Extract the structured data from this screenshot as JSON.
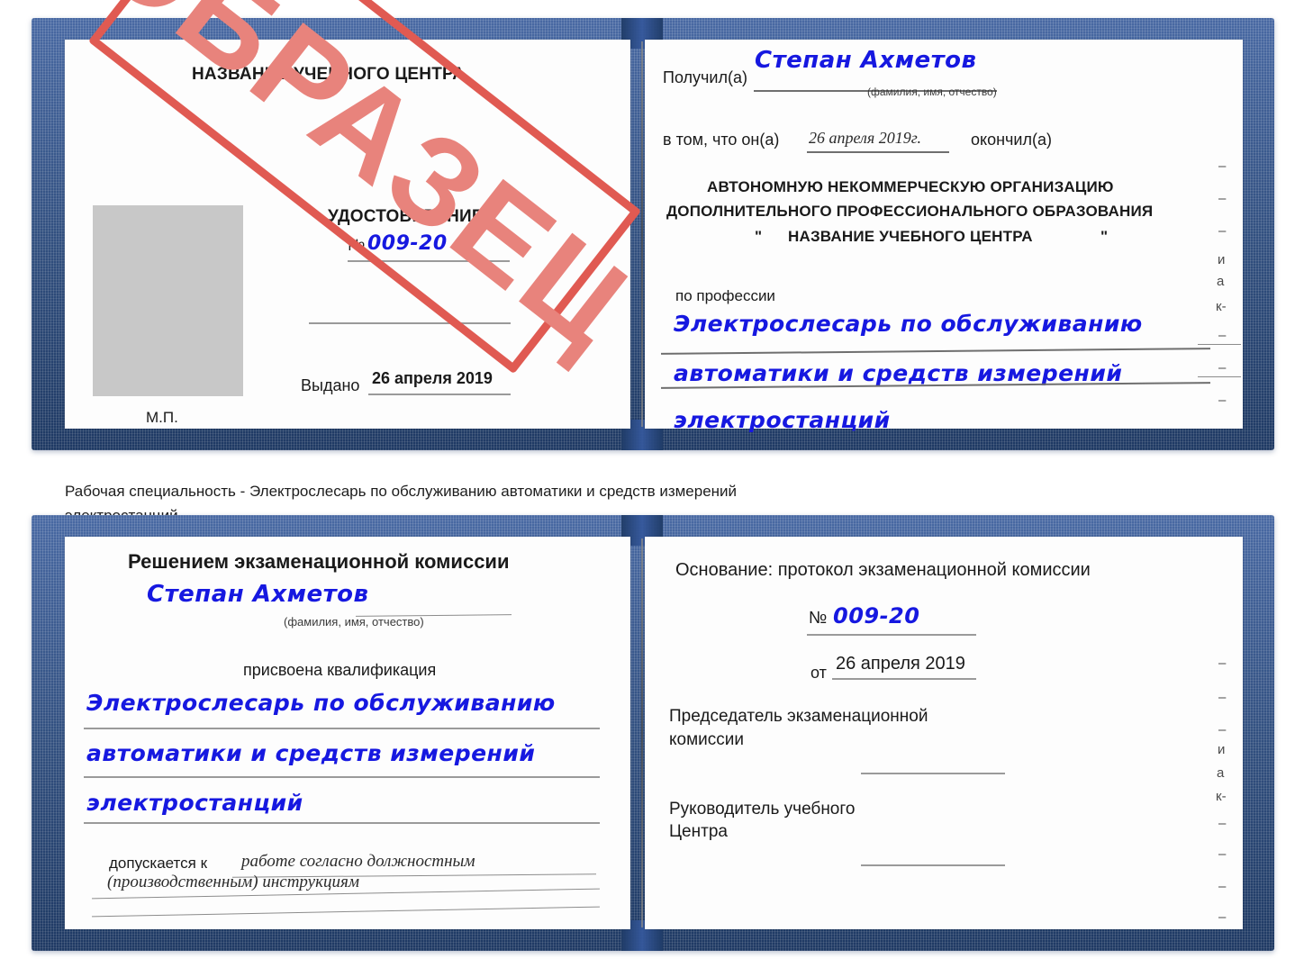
{
  "document": {
    "kind": "Удостоверение (свидетельство) о профессиональном обучении",
    "watermark": "ОБРАЗЕЦ"
  },
  "caption": {
    "line1": "Рабочая специальность - Электрослесарь по обслуживанию автоматики и средств измерений",
    "line2": "электростанций"
  },
  "cert_top": {
    "left_page": {
      "center_title": "НАЗВАНИЕ УЧЕБНОГО ЦЕНТРА",
      "doc_title": "УДОСТОВЕРЕНИЕ",
      "number_label": "№",
      "number_value": "009-20",
      "issued_label": "Выдано",
      "issued_value": "26 апреля 2019",
      "seal_label": "М.П.",
      "photo_placeholder": "photo-area"
    },
    "right_page": {
      "received_label": "Получил(а)",
      "received_value": "Степан Ахметов",
      "received_hint": "(фамилия, имя, отчество)",
      "in_that_label": "в том, что он(а)",
      "completion_date": "26 апреля 2019г.",
      "finished_label": "окончил(а)",
      "org_line1": "АВТОНОМНУЮ НЕКОММЕРЧЕСКУЮ ОРГАНИЗАЦИЮ",
      "org_line2": "ДОПОЛНИТЕЛЬНОГО ПРОФЕССИОНАЛЬНОГО ОБРАЗОВАНИЯ",
      "org_quote_open": "\"",
      "org_name": "НАЗВАНИЕ УЧЕБНОГО ЦЕНТРА",
      "org_quote_close": "\"",
      "profession_label": "по профессии",
      "profession_line1": "Электрослесарь по обслуживанию",
      "profession_line2": "автоматики и средств измерений",
      "profession_line3": "электростанций",
      "margin_fragments": [
        "–",
        "–",
        "–",
        "и",
        "а",
        "к-",
        "–",
        "–",
        "–"
      ]
    }
  },
  "cert_bottom": {
    "left_page": {
      "heading": "Решением экзаменационной комиссии",
      "name_value": "Степан Ахметов",
      "name_hint": "(фамилия, имя, отчество)",
      "qualification_label": "присвоена квалификация",
      "qualification_line1": "Электрослесарь по обслуживанию",
      "qualification_line2": "автоматики и средств измерений",
      "qualification_line3": "электростанций",
      "admitted_label": "допускается к",
      "admitted_line1": "работе согласно должностным",
      "admitted_line2": "(производственным) инструкциям"
    },
    "right_page": {
      "basis_label": "Основание: протокол экзаменационной комиссии",
      "number_label": "№",
      "number_value": "009-20",
      "date_label": "от",
      "date_value": "26 апреля 2019",
      "chairman_line1": "Председатель экзаменационной",
      "chairman_line2": "комиссии",
      "head_line1": "Руководитель учебного",
      "head_line2": "Центра",
      "margin_fragments": [
        "–",
        "–",
        "–",
        "и",
        "а",
        "к-",
        "–",
        "–",
        "–",
        "–"
      ]
    }
  },
  "colors": {
    "cover_blue": "#2f5496",
    "handwriting_blue": "#1618e0",
    "stamp_red": "#e05a52",
    "rule_gray": "#9a9a9a",
    "photo_gray": "#c8c8c8"
  }
}
